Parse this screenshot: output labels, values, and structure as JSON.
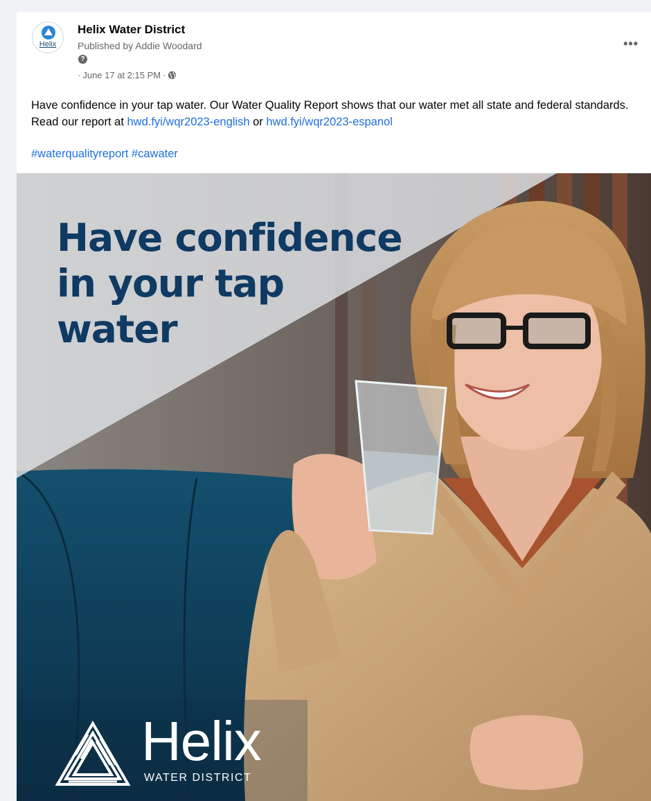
{
  "post": {
    "page_name": "Helix Water District",
    "published_by": "Published by Addie Woodard",
    "timestamp": "June 17 at 2:15 PM",
    "separator": "·",
    "more_label": "•••",
    "help_glyph": "?",
    "avatar_text": "Helix",
    "body_prefix": "Have confidence in your tap water. Our Water Quality Report shows that our water met all state and federal standards. Read our report at ",
    "link_english": "hwd.fyi/wqr2023-english",
    "body_or": " or ",
    "link_espanol": "hwd.fyi/wqr2023-espanol",
    "hashtags": [
      "#waterqualityreport",
      "#cawater"
    ]
  },
  "image": {
    "headline": [
      "Have confidence",
      "in your tap",
      "water"
    ],
    "logo_word": "Helix",
    "logo_sub": "WATER DISTRICT"
  },
  "icons": {
    "avatar_logo": "helix-triangle-icon",
    "help": "question-icon",
    "audience": "globe-icon",
    "more": "more-options-icon"
  },
  "colors": {
    "link": "#216fdb",
    "headline": "#0f3a63",
    "secondary_text": "#65676b"
  }
}
